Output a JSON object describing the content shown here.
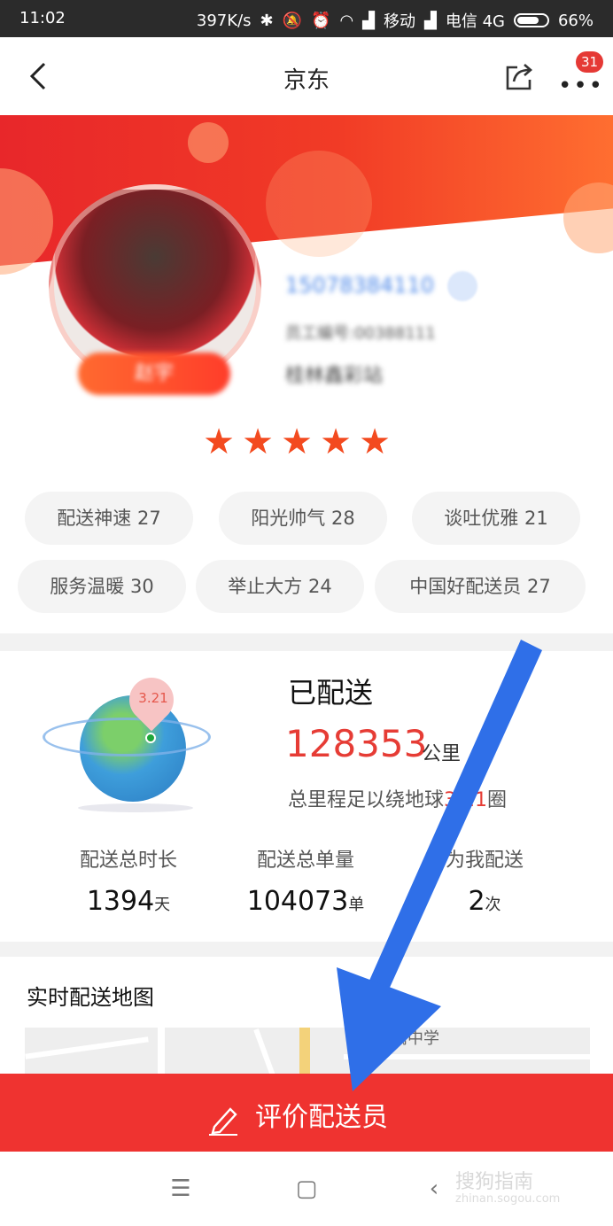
{
  "status_bar": {
    "time": "11:02",
    "speed": "397K/s",
    "carrier1": "移动",
    "carrier2": "电信 4G",
    "battery": "66%",
    "icons": [
      "bluetooth-icon",
      "mute-icon",
      "alarm-icon",
      "wifi-icon",
      "signal-icon",
      "battery-icon"
    ]
  },
  "navbar": {
    "title": "京东",
    "badge_count": "31",
    "icons": [
      "back-icon",
      "share-icon",
      "more-icon"
    ]
  },
  "courier": {
    "name": "赵宇",
    "phone": "15078384110",
    "employee_no": "员工编号:00388111",
    "station": "桂林鑫彩站",
    "rating_stars": 5
  },
  "tags": [
    {
      "label": "配送神速 27"
    },
    {
      "label": "阳光帅气 28"
    },
    {
      "label": "谈吐优雅 21"
    },
    {
      "label": "服务温暖 30"
    },
    {
      "label": "举止大方 24"
    },
    {
      "label": "中国好配送员 27"
    }
  ],
  "delivery": {
    "title": "已配送",
    "pin_value": "3.21",
    "distance": "128353",
    "distance_unit": "公里",
    "earth_prefix": "总里程足以绕地球",
    "earth_laps": "3.21",
    "earth_suffix": "圈",
    "stats": [
      {
        "label": "配送总时长",
        "value": "1394",
        "unit": "天"
      },
      {
        "label": "配送总单量",
        "value": "104073",
        "unit": "单"
      },
      {
        "label": "为我配送",
        "value": "2",
        "unit": "次"
      }
    ]
  },
  "map": {
    "title": "实时配送地图",
    "place_label": "附属中学"
  },
  "review_button": {
    "label": "评价配送员"
  },
  "system_nav": {
    "watermark": "搜狗指南",
    "watermark_url": "zhinan.sogou.com"
  },
  "colors": {
    "accent": "#ef3330",
    "banner_start": "#e8272a",
    "banner_end": "#ff6e30",
    "arrow": "#2f6fe8"
  }
}
